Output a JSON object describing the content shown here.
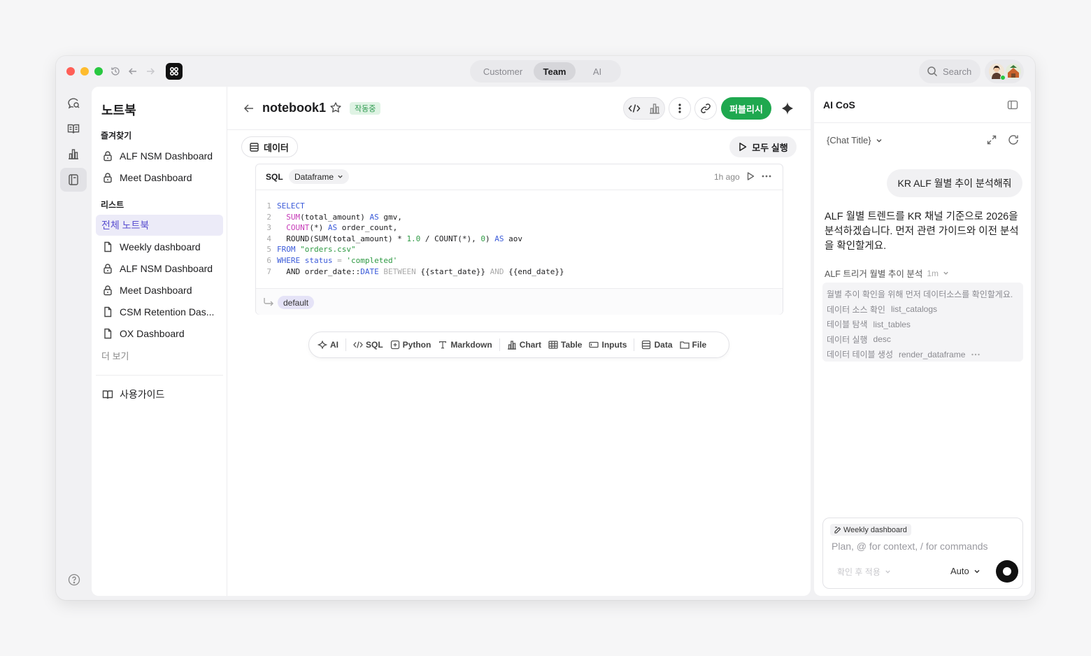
{
  "titlebar": {
    "tabs": [
      "Customer",
      "Team",
      "AI"
    ],
    "active_tab": "Team",
    "search_label": "Search"
  },
  "sidebar": {
    "title": "노트북",
    "favorites_label": "즐겨찾기",
    "favorites": [
      "ALF NSM Dashboard",
      "Meet Dashboard"
    ],
    "list_label": "리스트",
    "list": [
      {
        "label": "전체 노트북",
        "icon": "none",
        "active": true
      },
      {
        "label": "Weekly dashboard",
        "icon": "file-icon"
      },
      {
        "label": "ALF NSM Dashboard",
        "icon": "lock-icon"
      },
      {
        "label": "Meet Dashboard",
        "icon": "lock-icon"
      },
      {
        "label": "CSM Retention Das...",
        "icon": "file-icon"
      },
      {
        "label": "OX Dashboard",
        "icon": "file-icon"
      }
    ],
    "more_label": "더 보기",
    "guide_label": "사용가이드"
  },
  "notebook": {
    "title": "notebook1",
    "status_badge": "작동중",
    "publish_label": "퍼블리시",
    "data_label": "데이터",
    "run_all_label": "모두 실행"
  },
  "cell": {
    "language": "SQL",
    "format": "Dataframe",
    "time": "1h ago",
    "output_var": "default",
    "line_numbers": [
      "1",
      "2",
      "3",
      "4",
      "5",
      "6",
      "7"
    ]
  },
  "add_cell_toolbar": {
    "ai": "AI",
    "sql": "SQL",
    "python": "Python",
    "markdown": "Markdown",
    "chart": "Chart",
    "table": "Table",
    "inputs": "Inputs",
    "data": "Data",
    "file": "File"
  },
  "right_panel": {
    "title": "AI CoS",
    "chat_title": "{Chat Title}",
    "user_message": "KR ALF 월별 추이 분석해줘",
    "ai_message": "ALF 월별 트렌드를 KR 채널 기준으로 2026을 분석하겠습니다. 먼저 관련 가이드와 이전 분석을 확인할게요.",
    "trace_title": "ALF 트리거 월별 추이 분석",
    "trace_time": "1m",
    "trace_intro": "월별 추이 확인을 위해 먼저 데이터소스를 확인할게요.",
    "trace_steps": [
      {
        "label": "데이터 소스 확인",
        "tool": "list_catalogs"
      },
      {
        "label": "테이블 탐색",
        "tool": "list_tables"
      },
      {
        "label": "데이터 실행",
        "tool": "desc"
      },
      {
        "label": "데이터 테이블 생성",
        "tool": "render_dataframe"
      }
    ],
    "composer": {
      "context_chip": "Weekly dashboard",
      "placeholder": "Plan, @ for context, / for commands",
      "apply_mode": "확인 후 적용",
      "model": "Auto"
    }
  },
  "colors": {
    "accent_green": "#1fa84f",
    "active_list": "#5a4fd0",
    "keyword_blue": "#3b5bd9",
    "function_pink": "#c63ab8",
    "string_green": "#2f9a44"
  }
}
